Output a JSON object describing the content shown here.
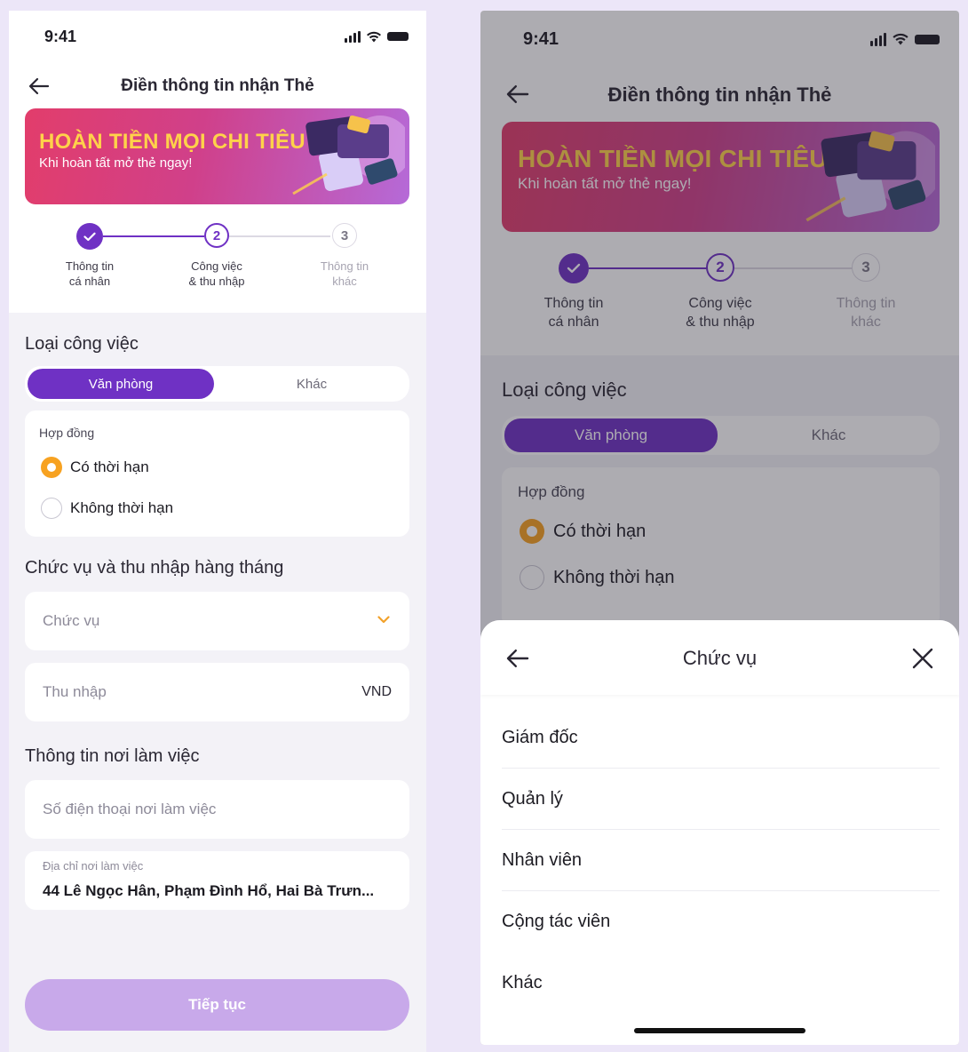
{
  "status": {
    "time": "9:41"
  },
  "screen": {
    "title": "Điền thông tin nhận Thẻ",
    "banner": {
      "headline": "HOÀN TIỀN MỌI CHI TIÊU",
      "sub": "Khi hoàn tất mở thẻ ngay!"
    },
    "steps": [
      {
        "number": "1",
        "line1": "Thông tin",
        "line2": "cá nhân",
        "state": "done"
      },
      {
        "number": "2",
        "line1": "Công việc",
        "line2": "& thu nhập",
        "state": "active"
      },
      {
        "number": "3",
        "line1": "Thông tin",
        "line2": "khác",
        "state": "pending"
      }
    ],
    "job_type": {
      "title": "Loại công việc",
      "options": [
        "Văn phòng",
        "Khác"
      ],
      "selected": "Văn phòng"
    },
    "contract": {
      "label": "Hợp đồng",
      "options": [
        "Có thời hạn",
        "Không thời hạn"
      ],
      "selected": "Có thời hạn"
    },
    "position_income": {
      "title": "Chức vụ và thu nhập hàng tháng",
      "position_placeholder": "Chức vụ",
      "income_placeholder": "Thu nhập",
      "currency": "VND"
    },
    "workplace": {
      "title": "Thông tin nơi làm việc",
      "phone_placeholder": "Số điện thoại nơi làm việc",
      "address_label": "Địa chỉ nơi làm việc",
      "address_value": "44 Lê Ngọc Hân, Phạm Đình Hổ, Hai Bà Trưn..."
    },
    "continue_label": "Tiếp tục"
  },
  "sheet": {
    "title": "Chức vụ",
    "items": [
      "Giám đốc",
      "Quản lý",
      "Nhân viên",
      "Cộng tác viên",
      "Khác"
    ]
  },
  "colors": {
    "primary": "#6f31c4",
    "accent": "#f7a221",
    "banner_headline": "#ffd24a",
    "button_disabled": "#c8a9ea",
    "background": "#ece6f8"
  }
}
